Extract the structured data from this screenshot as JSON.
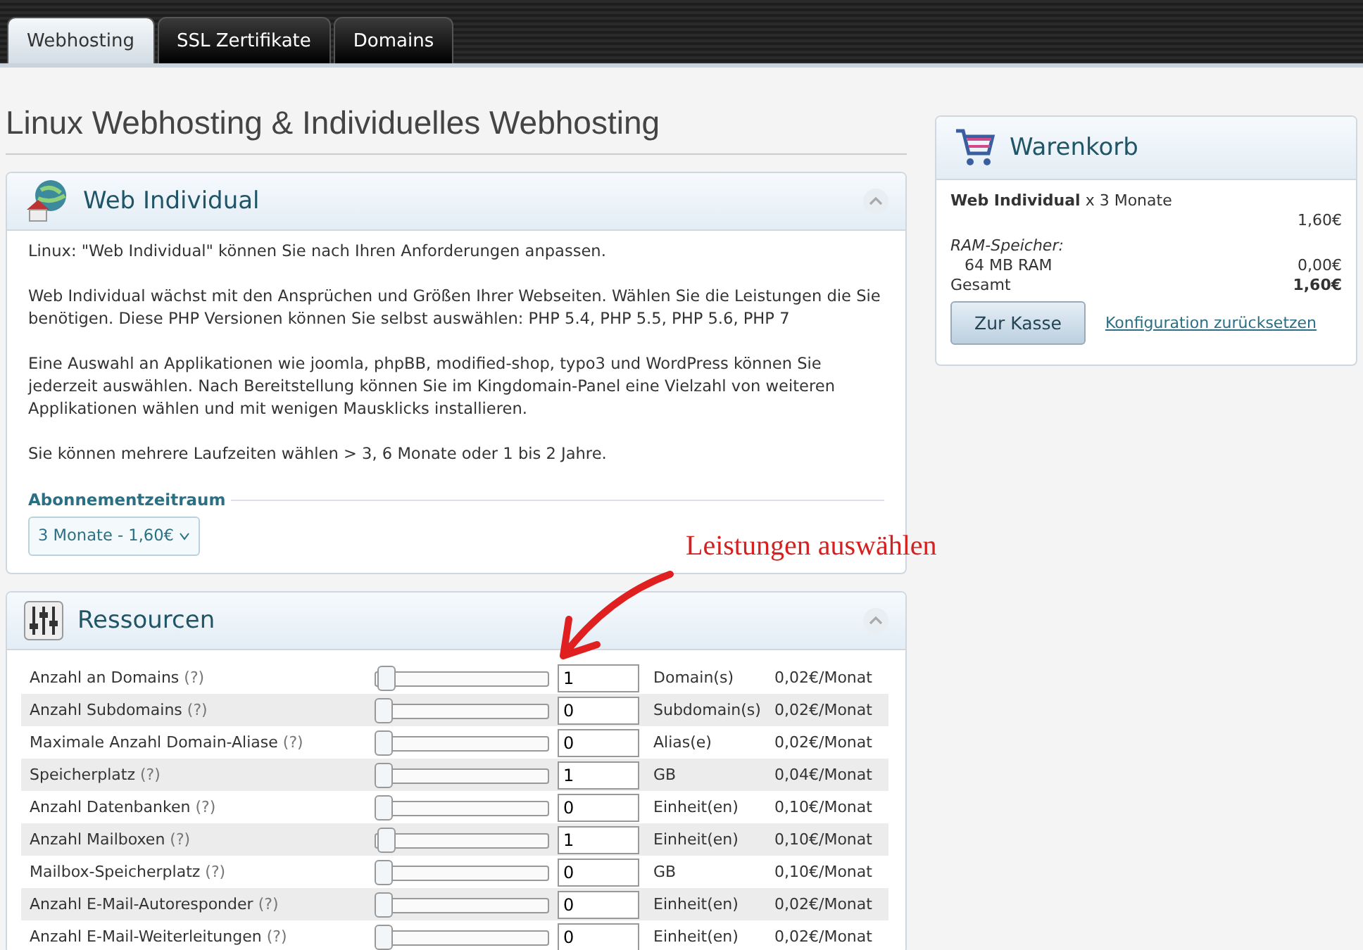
{
  "tabs": [
    {
      "label": "Webhosting",
      "selected": true
    },
    {
      "label": "SSL Zertifikate",
      "selected": false
    },
    {
      "label": "Domains",
      "selected": false
    }
  ],
  "page_title": "Linux Webhosting & Individuelles Webhosting",
  "product_panel": {
    "title": "Web Individual",
    "expanded": true,
    "paragraphs": [
      "Linux: \"Web Individual\" können Sie nach Ihren Anforderungen anpassen.",
      "Web Individual wächst mit den Ansprüchen und Größen Ihrer Webseiten. Wählen Sie die Leistungen die Sie benötigen. Diese PHP Versionen können Sie selbst auswählen: PHP 5.4, PHP 5.5, PHP 5.6, PHP 7",
      "Eine Auswahl an Applikationen wie joomla, phpBB, modified-shop, typo3 und WordPress können Sie jederzeit auswählen. Nach Bereitstellung können Sie im Kingdomain-Panel eine Vielzahl von weiteren Applikationen wählen und mit wenigen Mausklicks installieren.",
      "Sie können mehrere Laufzeiten wählen > 3, 6 Monate oder 1 bis 2 Jahre."
    ],
    "subscription_label": "Abonnementzeitraum",
    "subscription_value": "3 Monate - 1,60€"
  },
  "annotation": "Leistungen auswählen",
  "resources_panel": {
    "title": "Ressourcen",
    "expanded": true,
    "rows": [
      {
        "label": "Anzahl an Domains",
        "help": "(?)",
        "level": 0.02,
        "value": "1",
        "unit": "Domain(s)",
        "price": "0,02€/Monat"
      },
      {
        "label": "Anzahl Subdomains",
        "help": "(?)",
        "level": 0,
        "value": "0",
        "unit": "Subdomain(s)",
        "price": "0,02€/Monat"
      },
      {
        "label": "Maximale Anzahl Domain-Aliase",
        "help": "(?)",
        "level": 0,
        "value": "0",
        "unit": "Alias(e)",
        "price": "0,02€/Monat"
      },
      {
        "label": "Speicherplatz",
        "help": "(?)",
        "level": 0,
        "value": "1",
        "unit": "GB",
        "price": "0,04€/Monat"
      },
      {
        "label": "Anzahl Datenbanken",
        "help": "(?)",
        "level": 0,
        "value": "0",
        "unit": "Einheit(en)",
        "price": "0,10€/Monat"
      },
      {
        "label": "Anzahl Mailboxen",
        "help": "(?)",
        "level": 0.02,
        "value": "1",
        "unit": "Einheit(en)",
        "price": "0,10€/Monat"
      },
      {
        "label": "Mailbox-Speicherplatz",
        "help": "(?)",
        "level": 0,
        "value": "0",
        "unit": "GB",
        "price": "0,10€/Monat"
      },
      {
        "label": "Anzahl E-Mail-Autoresponder",
        "help": "(?)",
        "level": 0,
        "value": "0",
        "unit": "Einheit(en)",
        "price": "0,02€/Monat"
      },
      {
        "label": "Anzahl E-Mail-Weiterleitungen",
        "help": "(?)",
        "level": 0,
        "value": "0",
        "unit": "Einheit(en)",
        "price": "0,02€/Monat"
      }
    ]
  },
  "cart": {
    "title": "Warenkorb",
    "product": "Web Individual",
    "duration": "x 3 Monate",
    "product_price": "1,60€",
    "option_label": "RAM-Speicher:",
    "option_value": "64 MB RAM",
    "option_price": "0,00€",
    "total_label": "Gesamt",
    "total_price": "1,60€",
    "checkout_button": "Zur Kasse",
    "reset_link": "Konfiguration zurücksetzen"
  }
}
